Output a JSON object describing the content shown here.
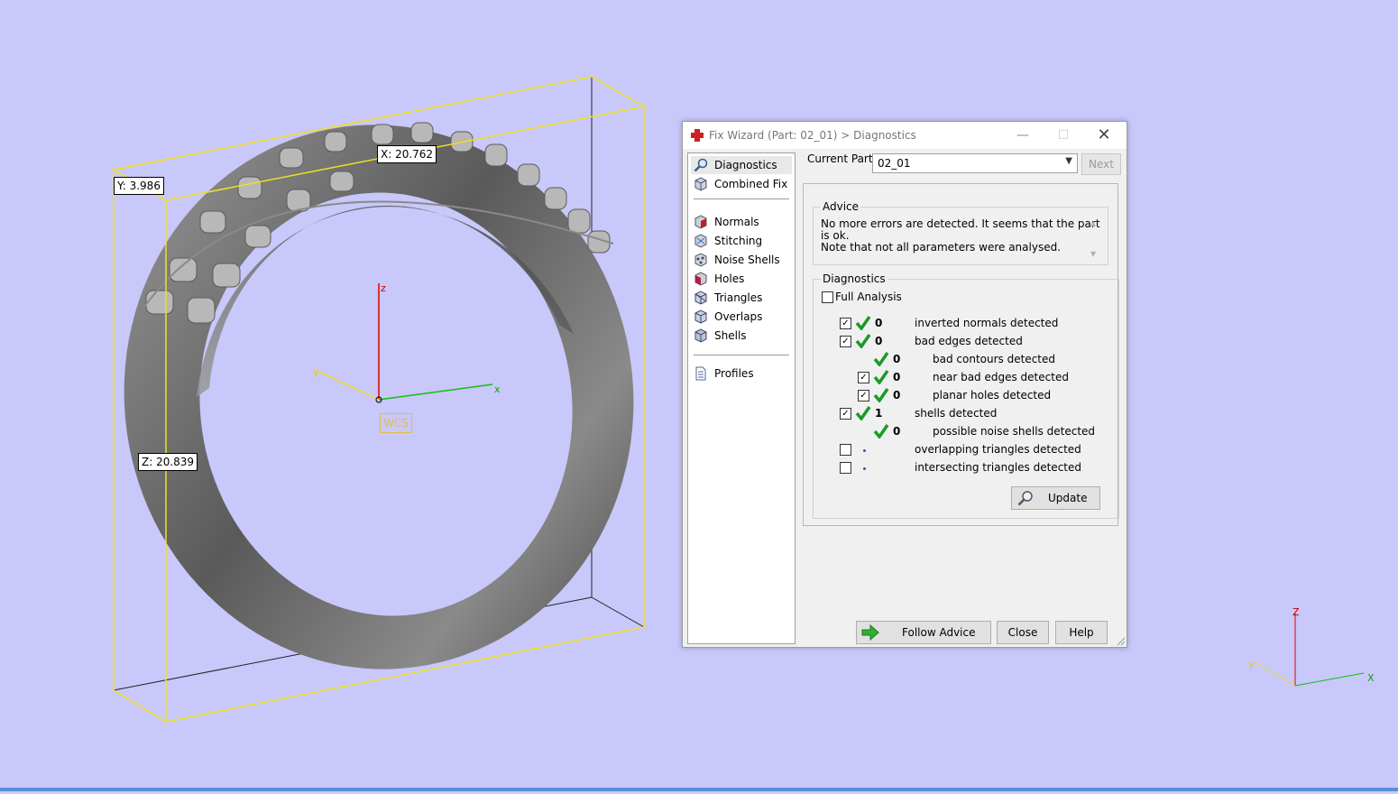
{
  "viewport": {
    "dimensions": {
      "x": "X: 20.762",
      "y": "Y: 3.986",
      "z": "Z: 20.839"
    },
    "wcs_label": "WCS",
    "axis_labels": {
      "x": "x",
      "y": "y",
      "z": "z"
    },
    "corner_axes": {
      "x": "X",
      "y": "Y",
      "z": "Z"
    }
  },
  "dialog": {
    "title": "Fix Wizard (Part: 02_01) > Diagnostics",
    "sidebar": [
      {
        "label": "Diagnostics",
        "icon": "magnifier-icon",
        "selected": true
      },
      {
        "label": "Combined Fix",
        "icon": "cube-icon"
      },
      {
        "label": "Normals",
        "icon": "normals-cube-icon"
      },
      {
        "label": "Stitching",
        "icon": "stitching-cube-icon"
      },
      {
        "label": "Noise Shells",
        "icon": "noise-shells-cube-icon"
      },
      {
        "label": "Holes",
        "icon": "holes-cube-icon"
      },
      {
        "label": "Triangles",
        "icon": "triangles-cube-icon"
      },
      {
        "label": "Overlaps",
        "icon": "overlaps-cube-icon"
      },
      {
        "label": "Shells",
        "icon": "shells-cube-icon"
      },
      {
        "label": "Profiles",
        "icon": "document-icon"
      }
    ],
    "current_part_label": "Current Part:",
    "current_part_value": "02_01",
    "next_label": "Next",
    "advice": {
      "title": "Advice",
      "line1": "No more errors are detected. It seems that the part is ok.",
      "line2": "Note that not all parameters were analysed."
    },
    "diagnostics": {
      "title": "Diagnostics",
      "full_analysis_label": "Full Analysis",
      "full_analysis_checked": false,
      "rows": [
        {
          "checkbox": true,
          "checked": true,
          "status": "ok",
          "count": "0",
          "label": "inverted normals detected",
          "level": 0
        },
        {
          "checkbox": true,
          "checked": true,
          "status": "ok",
          "count": "0",
          "label": "bad edges detected",
          "level": 0
        },
        {
          "checkbox": false,
          "status": "ok",
          "count": "0",
          "label": "bad contours detected",
          "level": 1
        },
        {
          "checkbox": true,
          "checked": true,
          "status": "ok",
          "count": "0",
          "label": "near bad edges detected",
          "level": 1
        },
        {
          "checkbox": true,
          "checked": true,
          "status": "ok",
          "count": "0",
          "label": "planar holes detected",
          "level": 1
        },
        {
          "checkbox": true,
          "checked": true,
          "status": "ok",
          "count": "1",
          "label": "shells detected",
          "level": 0
        },
        {
          "checkbox": false,
          "status": "ok",
          "count": "0",
          "label": "possible noise shells detected",
          "level": 1
        },
        {
          "checkbox": true,
          "checked": false,
          "status": "pending",
          "count": "",
          "label": "overlapping triangles detected",
          "level": 0
        },
        {
          "checkbox": true,
          "checked": false,
          "status": "pending",
          "count": "",
          "label": "intersecting triangles detected",
          "level": 0
        }
      ],
      "update_label": "Update"
    },
    "buttons": {
      "follow_advice": "Follow Advice",
      "close": "Close",
      "help": "Help"
    }
  }
}
